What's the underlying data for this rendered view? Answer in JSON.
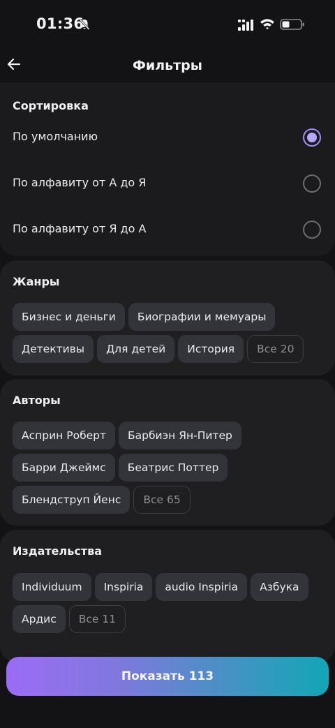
{
  "status_bar": {
    "time": "01:36"
  },
  "header": {
    "title": "Фильтры"
  },
  "sorting": {
    "title": "Сортировка",
    "options": [
      {
        "label": "По умолчанию",
        "selected": true
      },
      {
        "label": "По алфавиту от А до Я",
        "selected": false
      },
      {
        "label": "По алфавиту от Я до А",
        "selected": false
      }
    ]
  },
  "genres": {
    "title": "Жанры",
    "chips": [
      "Бизнес и деньги",
      "Биографии и мемуары",
      "Детективы",
      "Для детей",
      "История"
    ],
    "more": "Все 20"
  },
  "authors": {
    "title": "Авторы",
    "chips": [
      "Асприн Роберт",
      "Барбиэн Ян-Питер",
      "Барри Джеймс",
      "Беатрис Поттер",
      "Блендструп Йенс"
    ],
    "more": "Все 65"
  },
  "publishers": {
    "title": "Издательства",
    "chips": [
      "Individuum",
      "Inspiria",
      "audio Inspiria",
      "Азбука",
      "Ардис"
    ],
    "more": "Все 11"
  },
  "footer": {
    "show_label": "Показать 113"
  },
  "colors": {
    "background": "#131315",
    "card": "#1f1f22",
    "chip": "#33333a",
    "accent": "#b9a4ff",
    "gradient_start": "#9b6cf6",
    "gradient_end": "#12a6b6"
  }
}
